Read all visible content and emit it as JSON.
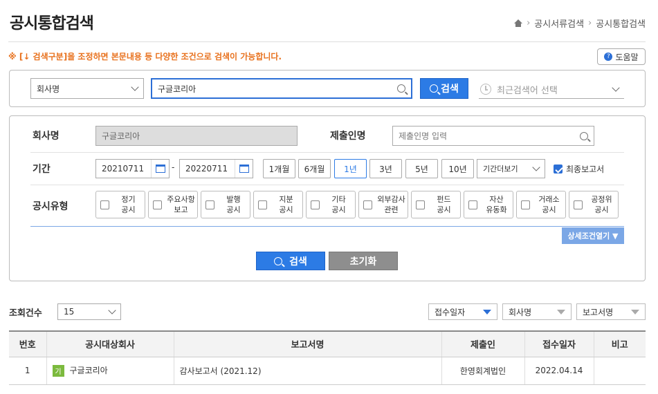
{
  "header": {
    "title": "공시통합검색",
    "breadcrumb": [
      "공시서류검색",
      "공시통합검색"
    ]
  },
  "notice": "※ [↓ 검색구분]을 조정하면 본문내용 등 다양한 조건으로 검색이 가능합니다.",
  "help_label": "도움말",
  "quick_search": {
    "category_value": "회사명",
    "query_value": "구글코리아",
    "search_label": "검색",
    "recent_placeholder": "최근검색어 선택"
  },
  "filters": {
    "company_label": "회사명",
    "company_value": "구글코리아",
    "submitter_label": "제출인명",
    "submitter_placeholder": "제출인명 입력",
    "period_label": "기간",
    "date_from": "20210711",
    "date_sep": "-",
    "date_to": "20220711",
    "periods": [
      "1개월",
      "6개월",
      "1년",
      "3년",
      "5년",
      "10년"
    ],
    "active_period": "1년",
    "more_periods": "기간더보기",
    "final_report_label": "최종보고서",
    "type_label": "공시유형",
    "types": [
      [
        "정기",
        "공시"
      ],
      [
        "주요사항",
        "보고"
      ],
      [
        "발행",
        "공시"
      ],
      [
        "지분",
        "공시"
      ],
      [
        "기타",
        "공시"
      ],
      [
        "외부감사",
        "관련"
      ],
      [
        "펀드",
        "공시"
      ],
      [
        "자산",
        "유동화"
      ],
      [
        "거래소",
        "공시"
      ],
      [
        "공정위",
        "공시"
      ]
    ],
    "detail_toggle": "상세조건열기 ▼",
    "search_button": "검색",
    "reset_button": "초기화"
  },
  "results": {
    "count_label": "조회건수",
    "page_size": "15",
    "sort_date": "접수일자",
    "sort_company": "회사명",
    "sort_report": "보고서명",
    "columns": [
      "번호",
      "공시대상회사",
      "보고서명",
      "제출인",
      "접수일자",
      "비고"
    ],
    "rows": [
      {
        "no": "1",
        "badge": "기",
        "company": "구글코리아",
        "report": "감사보고서 (2021.12)",
        "submitter": "한영회계법인",
        "date": "2022.04.14",
        "note": ""
      }
    ]
  },
  "colors": {
    "accent": "#2c7be5",
    "notice": "#e8711d",
    "badge": "#7cba3e"
  }
}
